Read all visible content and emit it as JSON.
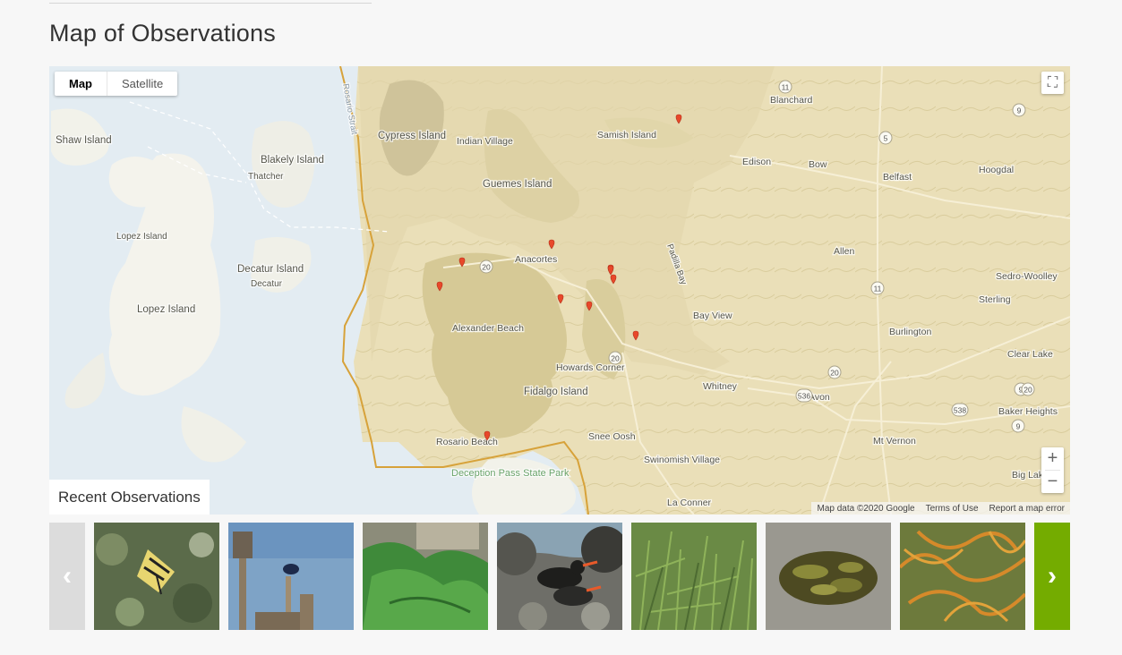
{
  "section": {
    "title": "Map of Observations"
  },
  "map": {
    "type_buttons": [
      "Map",
      "Satellite"
    ],
    "active_type": "Map",
    "fullscreen_icon": "⛶",
    "zoom_in": "+",
    "zoom_out": "−",
    "attribution": {
      "data": "Map data ©2020 Google",
      "terms": "Terms of Use",
      "report": "Report a map error"
    },
    "labels": {
      "shaw_island": "Shaw Island",
      "blakely_island": "Blakely Island",
      "thatcher": "Thatcher",
      "lopez_island_small": "Lopez Island",
      "lopez_island": "Lopez Island",
      "decatur_island": "Decatur Island",
      "decatur": "Decatur",
      "cypress_island": "Cypress Island",
      "indian_village": "Indian Village",
      "guemes_island": "Guemes Island",
      "samish_island": "Samish Island",
      "edison": "Edison",
      "bow": "Bow",
      "blanchard": "Blanchard",
      "belfast": "Belfast",
      "hoogdal": "Hoogdal",
      "anacortes": "Anacortes",
      "allen": "Allen",
      "sedro_woolley": "Sedro-Woolley",
      "sterling": "Sterling",
      "bay_view": "Bay View",
      "burlington": "Burlington",
      "clear_lake": "Clear Lake",
      "alexander_beach": "Alexander Beach",
      "howards_corner": "Howards Corner",
      "fidalgo_island": "Fidalgo Island",
      "whitney": "Whitney",
      "avon": "Avon",
      "baker_heights": "Baker Heights",
      "rosario_beach": "Rosario Beach",
      "snee_oosh": "Snee Oosh",
      "swinomish_village": "Swinomish Village",
      "deception_pass": "Deception Pass State Park",
      "mt_vernon": "Mt Vernon",
      "big_lake": "Big Lake",
      "la_conner": "La Conner",
      "padilla_bay": "Padilla Bay",
      "rosario_strait": "Rosario Strait"
    },
    "routes": [
      "20",
      "20",
      "20",
      "11",
      "5",
      "9",
      "9",
      "11",
      "536",
      "538",
      "9",
      "20"
    ],
    "observation_count": 11,
    "pin_color": "#e8482a"
  },
  "recent": {
    "label": "Recent Observations",
    "prev_icon": "‹",
    "next_icon": "›",
    "next_color": "#74ac00",
    "photos": [
      {
        "subject": "swallowtail-butterfly"
      },
      {
        "subject": "swallow-on-birdhouse"
      },
      {
        "subject": "sea-lettuce"
      },
      {
        "subject": "oystercatchers"
      },
      {
        "subject": "grass"
      },
      {
        "subject": "rockweed"
      },
      {
        "subject": "dodder"
      }
    ]
  }
}
